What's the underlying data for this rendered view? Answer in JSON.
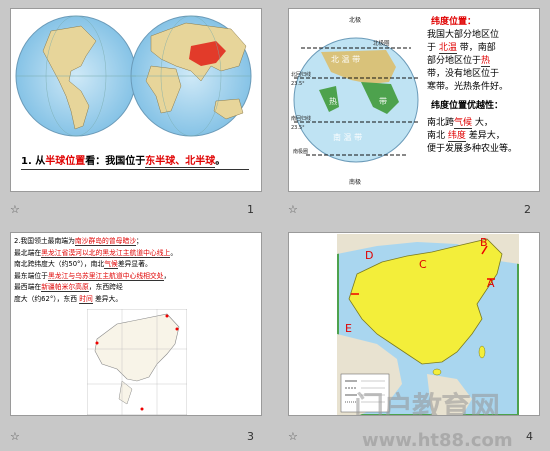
{
  "slides": [
    {
      "number": "1",
      "caption_prefix": "1. 从",
      "caption_keyword": "半球位置",
      "caption_mid": "看：我国位于",
      "caption_answer": "东半球、北半球",
      "caption_end": "。"
    },
    {
      "number": "2",
      "map_labels": {
        "north_pole": "北极",
        "arctic_circle": "北极圈",
        "north_temperate": "北 温 带",
        "tropic_cancer": "北回归线",
        "tropic_deg_n": "23.5°",
        "torrid": "热",
        "torrid2": "带",
        "tropic_capricorn": "南回归线",
        "tropic_deg_s": "23.5°",
        "south_temperate": "南 温 带",
        "antarctic_circle": "南极圈",
        "south_frigid": "南寒带",
        "south_pole": "南极"
      },
      "heading": "纬度位置：",
      "lines": [
        [
          "我国大部分地区位"
        ],
        [
          "于",
          "北温",
          "带，南部"
        ],
        [
          "部分地区位于",
          "热"
        ],
        [
          "带，没有地区位于"
        ],
        [
          "寒带。光热条件好。"
        ]
      ],
      "advantage_heading": "纬度位置优越性：",
      "adv_lines": [
        [
          "南北跨",
          "气候",
          "大，"
        ],
        [
          "南北",
          "纬度",
          "差异大，"
        ],
        [
          "便于发展多种农业等。"
        ]
      ]
    },
    {
      "number": "3",
      "text_lines": [
        [
          "2.我国领土最南端为",
          "南沙群岛的曾母暗沙",
          "；"
        ],
        [
          "最北端在",
          "黑龙江省漠河以北的黑龙江主航道中心线上",
          "。"
        ],
        [
          "南北跨纬度大（约50°），南北",
          "气候",
          "差异显著。"
        ],
        [
          "最东端位于",
          "黑龙江与乌苏里江主航道中心线相交处",
          "，"
        ],
        [
          "最西端在",
          "新疆帕米尔高原",
          "，东西跨经"
        ],
        [
          "度大（约62°），东西",
          "时间",
          "差异大。"
        ]
      ]
    },
    {
      "number": "4",
      "letters": {
        "a": "A",
        "b": "B",
        "c": "C",
        "d": "D",
        "e": "E"
      }
    }
  ],
  "watermark": {
    "brand": "门户教育网",
    "url": "www.ht88.com"
  },
  "star_glyph": "☆",
  "colors": {
    "red": "#e00000",
    "ocean": "#a9d6ef",
    "land_yellow": "#f3ee3a",
    "green": "#4da24d"
  }
}
